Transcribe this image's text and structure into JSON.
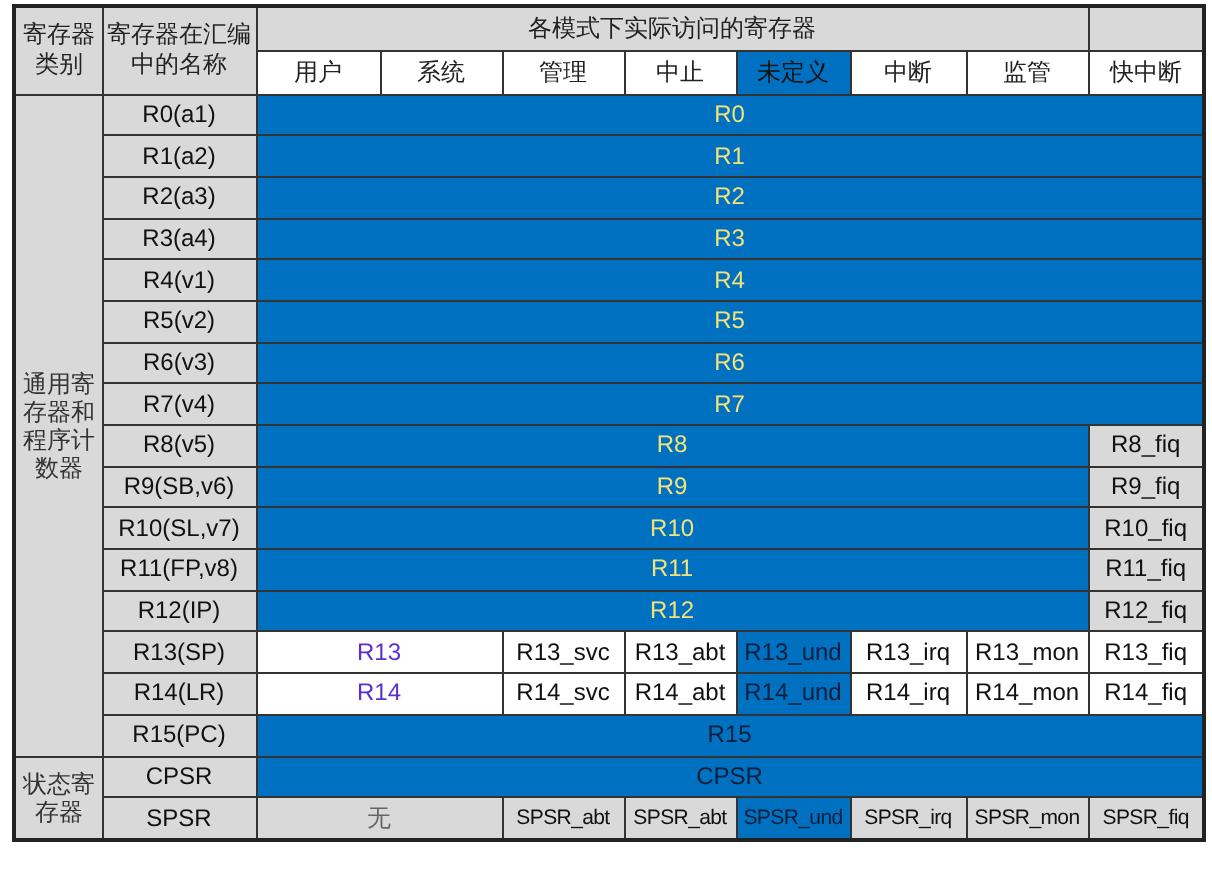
{
  "table": {
    "headers": {
      "category": "寄存器类别",
      "name": "寄存器在汇编中的名称",
      "modes_title": "各模式下实际访问的寄存器"
    },
    "modes": [
      {
        "label": "用户",
        "selected": false
      },
      {
        "label": "系统",
        "selected": false
      },
      {
        "label": "管理",
        "selected": false
      },
      {
        "label": "中止",
        "selected": false
      },
      {
        "label": "未定义",
        "selected": true
      },
      {
        "label": "中断",
        "selected": false
      },
      {
        "label": "监管",
        "selected": false
      },
      {
        "label": "快中断",
        "selected": false
      }
    ],
    "groups": [
      {
        "category": "通用寄存器和程序计数器",
        "rows": [
          {
            "name": "R0(a1)",
            "cells": [
              {
                "text": "R0",
                "colspan": 8,
                "kind": "shared"
              }
            ]
          },
          {
            "name": "R1(a2)",
            "cells": [
              {
                "text": "R1",
                "colspan": 8,
                "kind": "shared"
              }
            ]
          },
          {
            "name": "R2(a3)",
            "cells": [
              {
                "text": "R2",
                "colspan": 8,
                "kind": "shared"
              }
            ]
          },
          {
            "name": "R3(a4)",
            "cells": [
              {
                "text": "R3",
                "colspan": 8,
                "kind": "shared"
              }
            ]
          },
          {
            "name": "R4(v1)",
            "cells": [
              {
                "text": "R4",
                "colspan": 8,
                "kind": "shared"
              }
            ]
          },
          {
            "name": "R5(v2)",
            "cells": [
              {
                "text": "R5",
                "colspan": 8,
                "kind": "shared"
              }
            ]
          },
          {
            "name": "R6(v3)",
            "cells": [
              {
                "text": "R6",
                "colspan": 8,
                "kind": "shared"
              }
            ]
          },
          {
            "name": "R7(v4)",
            "cells": [
              {
                "text": "R7",
                "colspan": 8,
                "kind": "shared"
              }
            ]
          },
          {
            "name": "R8(v5)",
            "cells": [
              {
                "text": "R8",
                "colspan": 7,
                "kind": "shared"
              },
              {
                "text": "R8_fiq",
                "kind": "plain"
              }
            ]
          },
          {
            "name": "R9(SB,v6)",
            "cells": [
              {
                "text": "R9",
                "colspan": 7,
                "kind": "shared"
              },
              {
                "text": "R9_fiq",
                "kind": "plain"
              }
            ]
          },
          {
            "name": "R10(SL,v7)",
            "cells": [
              {
                "text": "R10",
                "colspan": 7,
                "kind": "shared"
              },
              {
                "text": "R10_fiq",
                "kind": "plain"
              }
            ]
          },
          {
            "name": "R11(FP,v8)",
            "cells": [
              {
                "text": "R11",
                "colspan": 7,
                "kind": "shared"
              },
              {
                "text": "R11_fiq",
                "kind": "plain"
              }
            ]
          },
          {
            "name": "R12(IP)",
            "cells": [
              {
                "text": "R12",
                "colspan": 7,
                "kind": "shared"
              },
              {
                "text": "R12_fiq",
                "kind": "plain"
              }
            ]
          },
          {
            "name": "R13(SP)",
            "cells": [
              {
                "text": "R13",
                "colspan": 2,
                "kind": "user"
              },
              {
                "text": "R13_svc",
                "kind": "banked"
              },
              {
                "text": "R13_abt",
                "kind": "banked"
              },
              {
                "text": "R13_und",
                "kind": "highlight"
              },
              {
                "text": "R13_irq",
                "kind": "banked"
              },
              {
                "text": "R13_mon",
                "kind": "banked"
              },
              {
                "text": "R13_fiq",
                "kind": "banked"
              }
            ]
          },
          {
            "name": "R14(LR)",
            "cells": [
              {
                "text": "R14",
                "colspan": 2,
                "kind": "user"
              },
              {
                "text": "R14_svc",
                "kind": "banked"
              },
              {
                "text": "R14_abt",
                "kind": "banked"
              },
              {
                "text": "R14_und",
                "kind": "highlight"
              },
              {
                "text": "R14_irq",
                "kind": "banked"
              },
              {
                "text": "R14_mon",
                "kind": "banked"
              },
              {
                "text": "R14_fiq",
                "kind": "banked"
              }
            ]
          },
          {
            "name": "R15(PC)",
            "cells": [
              {
                "text": "R15",
                "colspan": 8,
                "kind": "highlight"
              }
            ]
          }
        ]
      },
      {
        "category": "状态寄存器",
        "rows": [
          {
            "name": "CPSR",
            "cells": [
              {
                "text": "CPSR",
                "colspan": 8,
                "kind": "highlight"
              }
            ]
          },
          {
            "name": "SPSR",
            "cells": [
              {
                "text": "无",
                "colspan": 2,
                "kind": "none"
              },
              {
                "text": "SPSR_abt",
                "kind": "plain"
              },
              {
                "text": "SPSR_abt",
                "kind": "plain"
              },
              {
                "text": "SPSR_und",
                "kind": "highlight"
              },
              {
                "text": "SPSR_irq",
                "kind": "plain"
              },
              {
                "text": "SPSR_mon",
                "kind": "plain"
              },
              {
                "text": "SPSR_fiq",
                "kind": "plain"
              }
            ]
          }
        ]
      }
    ]
  }
}
